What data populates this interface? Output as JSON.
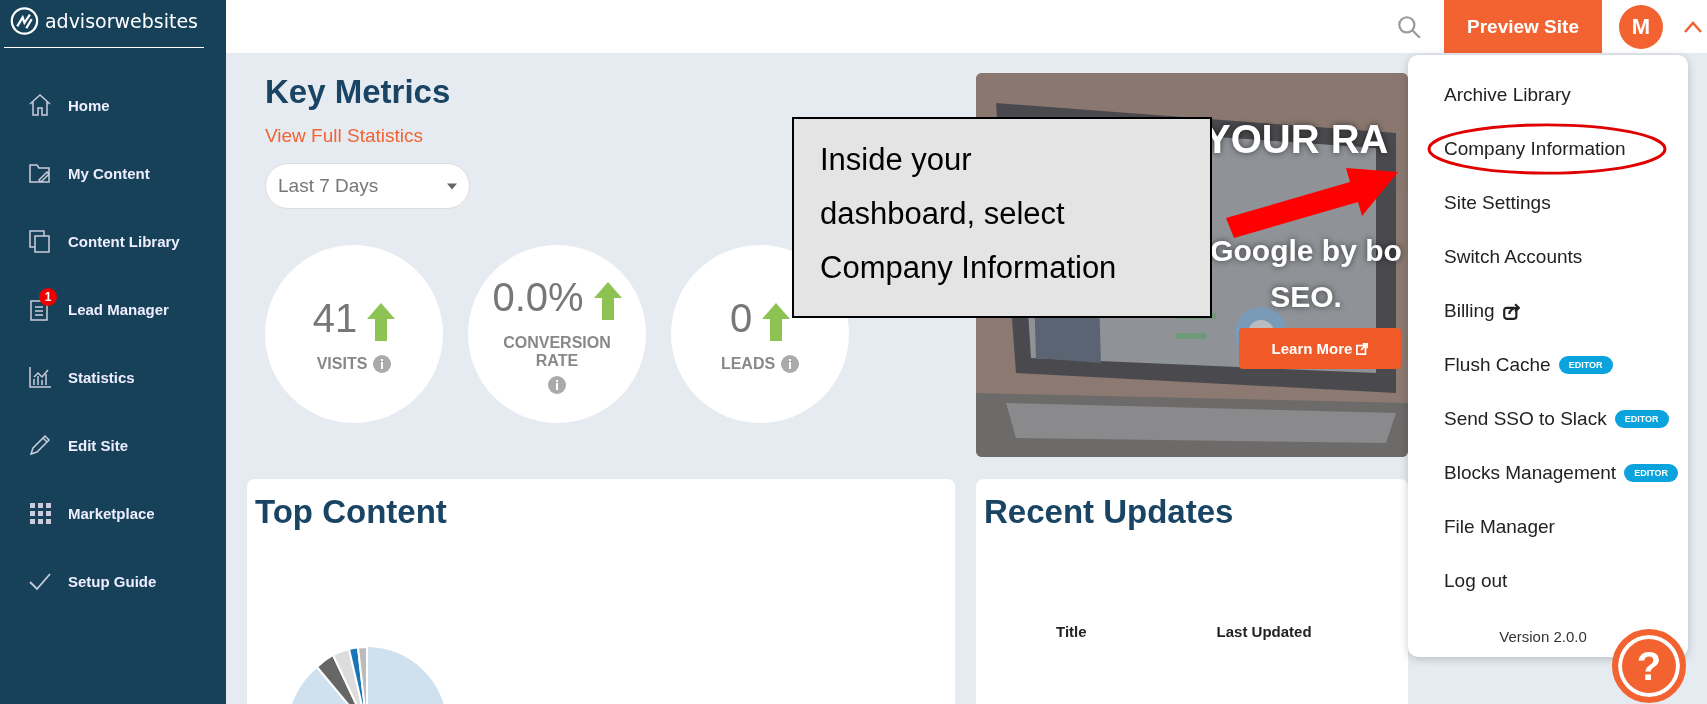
{
  "logo": {
    "text": "advisorwebsites"
  },
  "sidebar": {
    "items": [
      {
        "label": "Home"
      },
      {
        "label": "My Content"
      },
      {
        "label": "Content Library"
      },
      {
        "label": "Lead Manager",
        "badge": "1"
      },
      {
        "label": "Statistics"
      },
      {
        "label": "Edit Site"
      },
      {
        "label": "Marketplace"
      },
      {
        "label": "Setup Guide"
      }
    ]
  },
  "header": {
    "preview_button": "Preview Site",
    "avatar": "M",
    "menu_expanded": true
  },
  "key_metrics": {
    "title": "Key Metrics",
    "link": "View Full Statistics",
    "period": "Last 7 Days",
    "metrics": [
      {
        "value": "41",
        "label": "VISITS"
      },
      {
        "value": "0.0%",
        "label": "CONVERSION RATE"
      },
      {
        "value": "0",
        "label": "LEADS"
      }
    ]
  },
  "banner": {
    "kind": "picture",
    "headline": "YOUR RA",
    "lines": [
      "Google by bo",
      "SEO."
    ],
    "button": "Learn More"
  },
  "top_content": {
    "title": "Top Content"
  },
  "recent_updates": {
    "title": "Recent Updates",
    "columns": [
      "Title",
      "Last Updated"
    ]
  },
  "account_menu": {
    "items": [
      {
        "label": "Archive Library",
        "external": false,
        "circled": false
      },
      {
        "label": "Company Information",
        "external": false,
        "circled": true
      },
      {
        "label": "Site Settings",
        "external": false,
        "circled": false
      },
      {
        "label": "Switch Accounts",
        "external": false,
        "circled": false
      },
      {
        "label": "Billing",
        "external": true,
        "circled": false
      },
      {
        "label": "Flush Cache",
        "badge": "EDITOR",
        "external": false,
        "circled": false
      },
      {
        "label": "Send SSO to Slack",
        "badge": "EDITOR",
        "external": false,
        "circled": false
      },
      {
        "label": "Blocks Management",
        "badge": "EDITOR",
        "external": false,
        "circled": false
      },
      {
        "label": "File Manager",
        "external": false,
        "circled": false
      },
      {
        "label": "Log out",
        "external": false,
        "circled": false
      }
    ],
    "version": "Version 2.0.0"
  },
  "help_button": "?",
  "callout": {
    "lines": [
      "Inside your",
      "dashboard, select",
      "Company Information"
    ]
  }
}
